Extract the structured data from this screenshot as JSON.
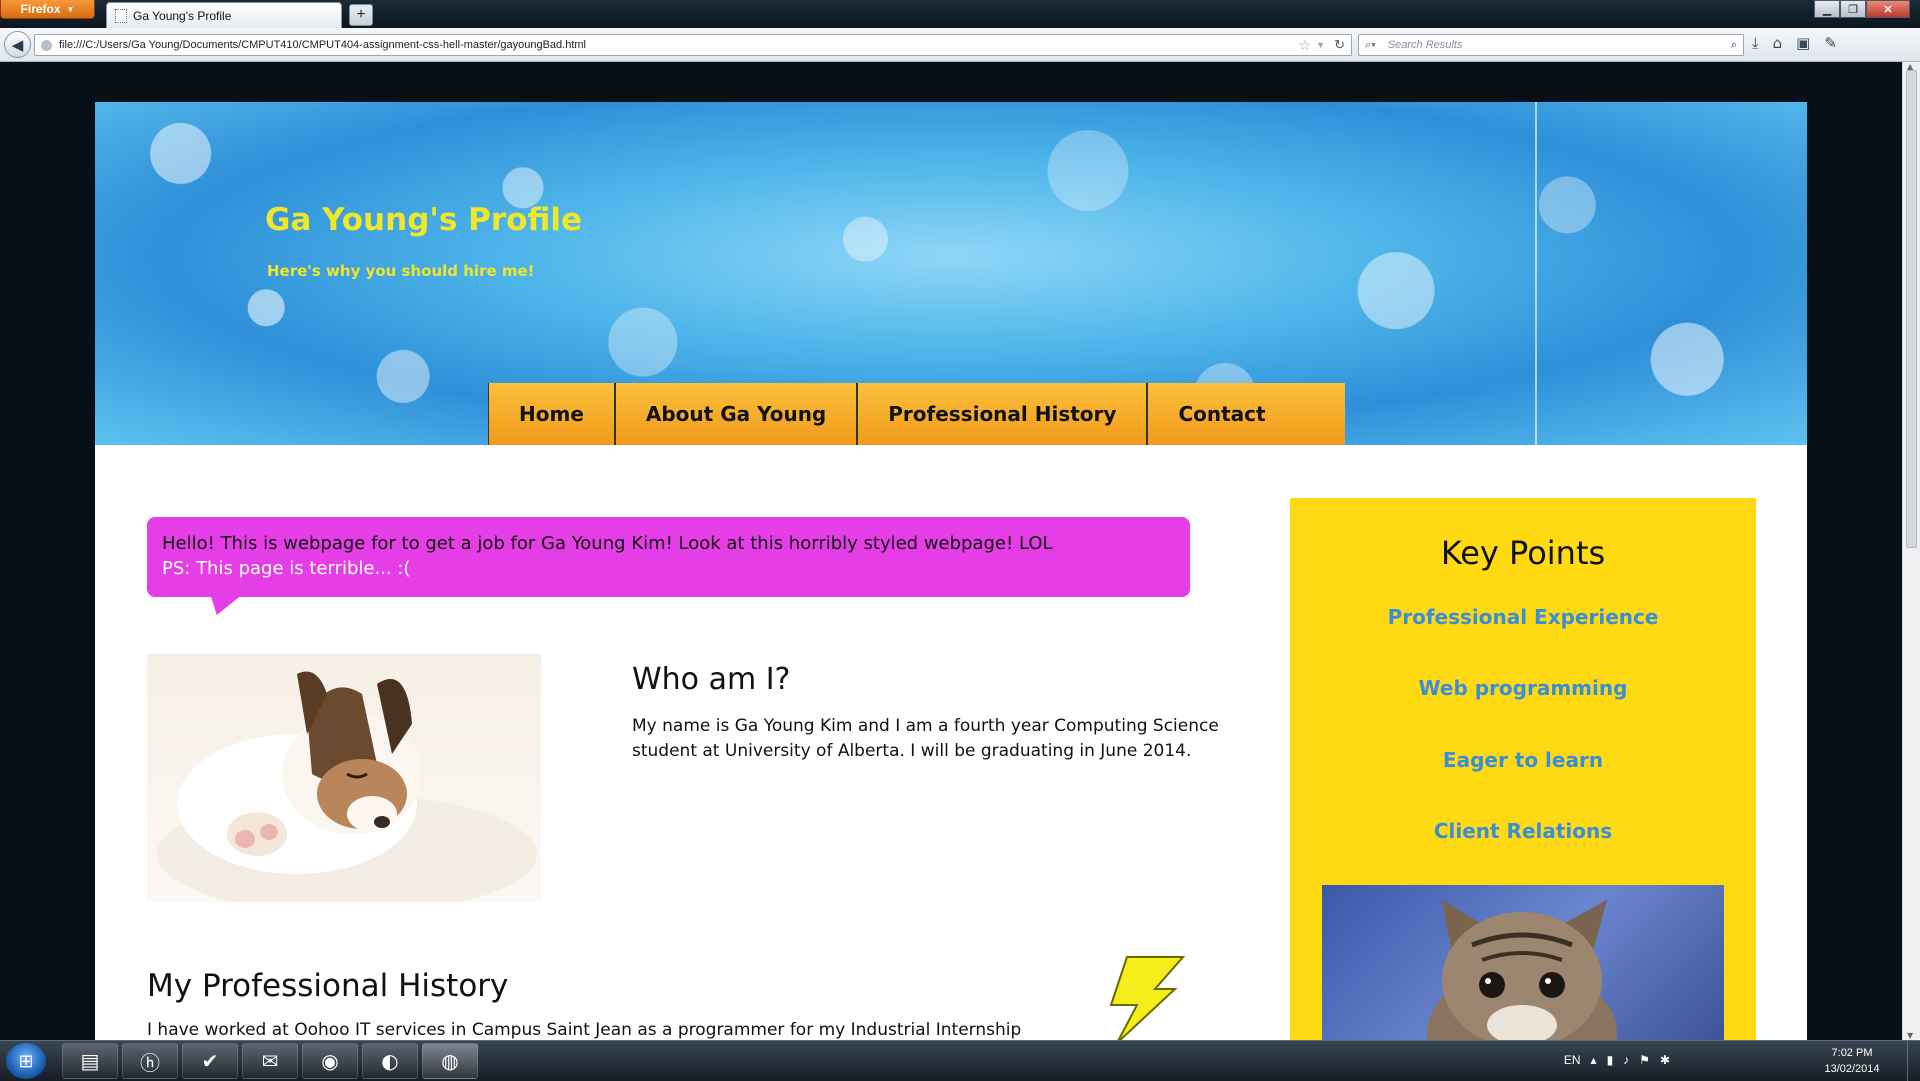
{
  "browser": {
    "app_button": "Firefox",
    "tab_title": "Ga Young's Profile",
    "new_tab": "+",
    "url": "file:///C:/Users/Ga Young/Documents/CMPUT410/CMPUT404-assignment-css-hell-master/gayoungBad.html",
    "search_placeholder": "Search Results",
    "toolbar_icons": [
      "download-icon",
      "home-icon",
      "addon-bar-icon",
      "tools-icon"
    ]
  },
  "site": {
    "title": "Ga Young's Profile",
    "subtitle": "Here's why you should hire me!",
    "nav": [
      "Home",
      "About Ga Young",
      "Professional History",
      "Contact"
    ],
    "bubble_line1": "Hello! This is webpage for to get a job for Ga Young Kim! Look at this horribly styled webpage! LOL",
    "bubble_line2": "PS: This page is terrible... :(",
    "about_heading": "Who am I?",
    "about_text": "My name is Ga Young Kim and I am a fourth year Computing Science student at University of Alberta. I will be graduating in June 2014.",
    "history_heading": "My Professional History",
    "history_text": "I have worked at Oohoo IT services in Campus Saint Jean as a programmer for my Industrial Internship",
    "sidebar": {
      "heading": "Key Points",
      "points": [
        "Professional Experience",
        "Web programming",
        "Eager to learn",
        "Client Relations"
      ]
    },
    "colors": {
      "title_yellow": "#f0e62a",
      "nav_orange": "#f7a823",
      "bubble_magenta": "#e63ee6",
      "sidebar_yellow": "#ffd912",
      "keypoint_blue": "#3a8ed8"
    }
  },
  "taskbar": {
    "language": "EN",
    "time": "7:02 PM",
    "date": "13/02/2014",
    "apps": [
      "hp-icon",
      "tasks-icon",
      "folder-icon",
      "chrome-icon",
      "eclipse-icon",
      "firefox-icon"
    ]
  }
}
